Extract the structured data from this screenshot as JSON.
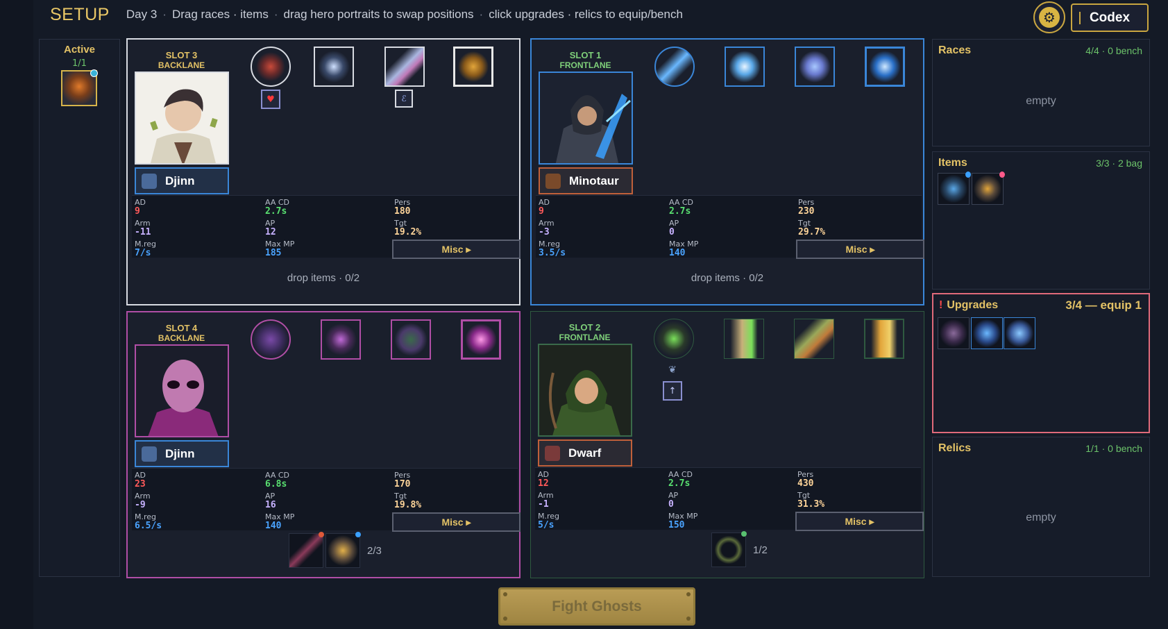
{
  "header": {
    "title": "SETUP",
    "day": "Day 3",
    "hint1": "Drag races · items",
    "hint2": "drag hero portraits to swap positions",
    "hint3": "click upgrades · relics to equip/bench",
    "codex_label": "Codex",
    "settings_icon": "gear-icon"
  },
  "active": {
    "label": "Active",
    "count": "1/1"
  },
  "slots": [
    {
      "title_line1": "SLOT 3",
      "title_line2": "BACKLANE",
      "race": "Djinn",
      "stats": {
        "ad": "9",
        "aa_cd": "2.7s",
        "pers": "180",
        "arm": "-11",
        "ap": "12",
        "tgt": "19.2%",
        "mreg": "7/s",
        "max_mp": "185"
      },
      "drop_text": "drop items · 0/2",
      "upgrade_icons": [
        "rose-icon",
        "spiral-orb-icon",
        "crystal-tool-icon",
        "gold-ore-icon"
      ],
      "sub_badges": [
        "heart-icon",
        "rune-icon"
      ]
    },
    {
      "title_line1": "SLOT 1",
      "title_line2": "FRONTLANE",
      "race": "Minotaur",
      "stats": {
        "ad": "9",
        "aa_cd": "2.7s",
        "pers": "230",
        "arm": "-3",
        "ap": "0",
        "tgt": "29.7%",
        "mreg": "3.5/s",
        "max_mp": "140"
      },
      "drop_text": "drop items · 0/2",
      "upgrade_icons": [
        "ice-blade-icon",
        "frost-burst-icon",
        "feather-wing-icon",
        "storm-orb-icon"
      ]
    },
    {
      "title_line1": "SLOT 4",
      "title_line2": "BACKLANE",
      "race": "Djinn",
      "stats": {
        "ad": "23",
        "aa_cd": "6.8s",
        "pers": "170",
        "arm": "-9",
        "ap": "16",
        "tgt": "19.8%",
        "mreg": "6.5/s",
        "max_mp": "140"
      },
      "item_count": "2/3",
      "upgrade_icons": [
        "rune-board-icon",
        "dark-wings-icon",
        "serpent-ring-icon",
        "void-portal-icon"
      ]
    },
    {
      "title_line1": "SLOT 2",
      "title_line2": "FRONTLANE",
      "race": "Dwarf",
      "stats": {
        "ad": "12",
        "aa_cd": "2.7s",
        "pers": "430",
        "arm": "-1",
        "ap": "0",
        "tgt": "31.3%",
        "mreg": "5/s",
        "max_mp": "150"
      },
      "item_count": "1/2",
      "upgrade_icons": [
        "green-star-icon",
        "arrow-bolt-icon",
        "quiver-icon",
        "triple-arrow-icon"
      ],
      "sub_badges": [
        "leaf-icon",
        "arrow-up-icon"
      ]
    }
  ],
  "stat_labels": {
    "ad": "AD",
    "aa_cd": "AA CD",
    "pers": "Pers",
    "arm": "Arm",
    "ap": "AP",
    "tgt": "Tgt",
    "mreg": "M.reg",
    "max_mp": "Max MP",
    "misc": "Misc ▸"
  },
  "panels": {
    "races": {
      "title": "Races",
      "count": "4/4 · 0 bench",
      "empty": "empty"
    },
    "items": {
      "title": "Items",
      "count": "3/3 · 2 bag"
    },
    "upgrades": {
      "title": "Upgrades",
      "count": "3/4 — equip 1",
      "warn": "!"
    },
    "relics": {
      "title": "Relics",
      "count": "1/1 · 0 bench",
      "empty": "empty"
    }
  },
  "fight_label": "Fight Ghosts",
  "colors": {
    "gold": "#e3c266",
    "front_green": "#7fd07a",
    "slot1_blue": "#3a86d8",
    "slot4_magenta": "#b04ea6",
    "warn_red": "#e06a7a"
  }
}
